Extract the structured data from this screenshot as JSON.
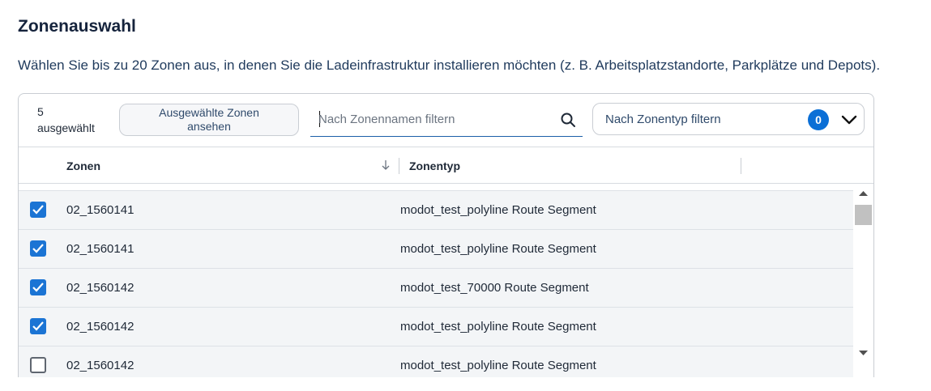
{
  "header": {
    "title": "Zonenauswahl",
    "description": "Wählen Sie bis zu 20 Zonen aus, in denen Sie die Ladeinfrastruktur installieren möchten (z. B. Arbeitsplatzstandorte, Parkplätze und Depots)."
  },
  "toolbar": {
    "selected_count": "5",
    "selected_label": "ausgewählt",
    "view_selected_button": "Ausgewählte Zonen ansehen",
    "name_filter_placeholder": "Nach Zonennamen filtern",
    "name_filter_value": "",
    "type_filter_label": "Nach Zonentyp filtern",
    "type_filter_count": "0"
  },
  "table": {
    "columns": [
      "Zonen",
      "Zonentyp"
    ],
    "rows": [
      {
        "zone": "02_1560141",
        "type": "modot_test_polyline Route Segment",
        "checked": true
      },
      {
        "zone": "02_1560141",
        "type": "modot_test_polyline Route Segment",
        "checked": true
      },
      {
        "zone": "02_1560142",
        "type": "modot_test_70000 Route Segment",
        "checked": true
      },
      {
        "zone": "02_1560142",
        "type": "modot_test_polyline Route Segment",
        "checked": true
      },
      {
        "zone": "02_1560142",
        "type": "modot_test_polyline Route Segment",
        "checked": false
      }
    ]
  },
  "colors": {
    "accent": "#1b74d4",
    "badge": "#0b6fd6",
    "title": "#15233c",
    "row_bg": "#f3f5f7"
  },
  "icons": {
    "search": "search-icon",
    "chevron": "chevron-down-icon",
    "sort": "arrow-down-icon",
    "check": "checkmark-icon"
  }
}
